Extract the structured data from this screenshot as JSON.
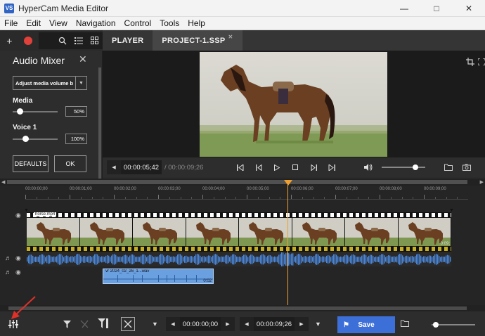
{
  "window": {
    "title": "HyperCam Media Editor",
    "app_icon_text": "VS"
  },
  "menu": [
    "File",
    "Edit",
    "View",
    "Navigation",
    "Control",
    "Tools",
    "Help"
  ],
  "tabs": [
    {
      "label": "PLAYER",
      "active": false
    },
    {
      "label": "PROJECT-1.SSP",
      "active": true
    }
  ],
  "mixer": {
    "title": "Audio Mixer",
    "mode_value": "Adjust media volume b",
    "channels": [
      {
        "label": "Media",
        "value": "50%",
        "level": 0.1
      },
      {
        "label": "Voice 1",
        "value": "100%",
        "level": 0.25
      }
    ],
    "defaults_label": "DEFAULTS",
    "ok_label": "OK"
  },
  "player": {
    "current_time": "00:00:05;42",
    "total_time": "/ 00:00:09;26",
    "volume_level": 0.8
  },
  "timeline": {
    "ruler_ticks": [
      "00:00:00;00",
      "00:00:01;00",
      "00:00:02;00",
      "00:00:03;00",
      "00:00:04;00",
      "00:00:05;00",
      "00:00:06;00",
      "00:00:07;00",
      "00:00:08;00",
      "00:00:09;00"
    ],
    "video_clip_label": "horse.mp4",
    "video_clip_end": "0:09;",
    "voice_clip_label": "vr 2024_02_26_1...wav",
    "voice_clip_end": "0:02"
  },
  "bottom": {
    "range_start": "00:00:00;00",
    "range_end": "00:00:09;26",
    "save_label": "Save"
  },
  "colors": {
    "accent": "#3d6fd8",
    "playhead": "#f0a030",
    "audio": "#4a86d8",
    "record": "#e0413a"
  }
}
